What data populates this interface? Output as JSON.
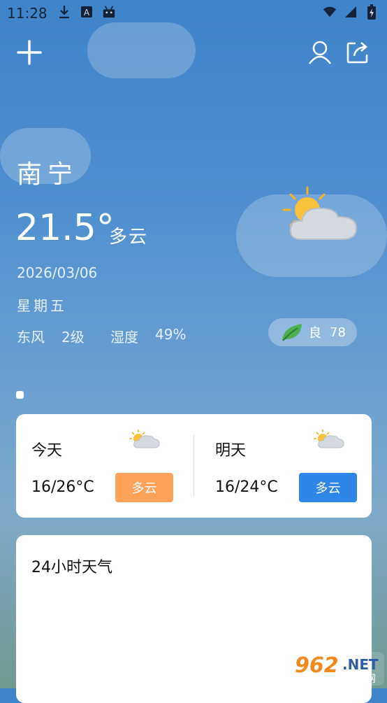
{
  "status_bar": {
    "time": "11:28",
    "left_icons": [
      "download-icon",
      "a-icon",
      "android-icon"
    ],
    "right_icons": [
      "wifi-icon",
      "signal-icon",
      "battery-icon"
    ]
  },
  "header": {
    "add_icon": "plus-icon",
    "user_icon": "user-icon",
    "share_icon": "share-icon"
  },
  "current": {
    "city": "南宁",
    "temperature": "21.5°",
    "condition": "多云",
    "date": "2026/03/06",
    "weekday": "星期五",
    "wind_dir": "东风",
    "wind_level": "2级",
    "humidity_label": "湿度",
    "humidity_value": "49%",
    "aqi_label": "良",
    "aqi_value": "78",
    "weather_icon": "partly-cloudy-icon",
    "leaf_icon": "leaf-icon"
  },
  "forecast": {
    "today": {
      "label": "今天",
      "range": "16/26°C",
      "condition": "多云",
      "badge_color": "#ffa25a"
    },
    "tomorrow": {
      "label": "明天",
      "range": "16/24°C",
      "condition": "多云",
      "badge_color": "#2e86e8"
    }
  },
  "hourly": {
    "title": "24小时天气"
  },
  "watermark": {
    "number": "962",
    "net": ".NET",
    "sub": "乐游网"
  }
}
